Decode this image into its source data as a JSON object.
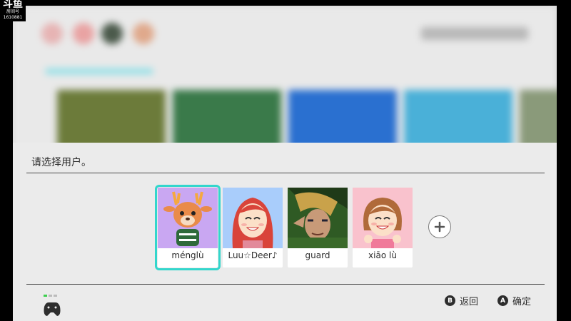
{
  "watermark": {
    "logo": "斗鱼",
    "line1": "房间号",
    "line2": "1610881"
  },
  "dialog": {
    "title": "请选择用户。",
    "users": [
      {
        "name": "ménglù",
        "selected": true,
        "bg": "#c9a7f2"
      },
      {
        "name": "Luu☆Deer♪",
        "selected": false,
        "bg": "#a9cdfb"
      },
      {
        "name": "guard",
        "selected": false,
        "bg": "#3f6b2d"
      },
      {
        "name": "xiāo lù",
        "selected": false,
        "bg": "#f9c2cd"
      }
    ],
    "add_icon": "plus-icon"
  },
  "footer": {
    "controller_icon": "controller-icon",
    "back": {
      "key": "B",
      "label": "返回"
    },
    "confirm": {
      "key": "A",
      "label": "确定"
    }
  },
  "colors": {
    "selection": "#33d6cc",
    "dialog_bg": "#ebebeb",
    "text": "#2d2d2d"
  }
}
